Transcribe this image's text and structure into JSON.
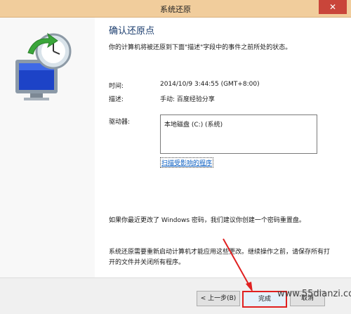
{
  "window": {
    "title": "系统还原",
    "close_glyph": "✕"
  },
  "main": {
    "heading": "确认还原点",
    "intro": "你的计算机将被还原到下面\"描述\"字段中的事件之前所处的状态。",
    "time_label": "时间:",
    "time_value": "2014/10/9 3:44:55 (GMT+8:00)",
    "desc_label": "描述:",
    "desc_value": "手动: 百度经验分享",
    "drives_label": "驱动器:",
    "drive_item": "本地磁盘 (C:) (系统)",
    "scan_link": "扫描受影响的程序",
    "password_note": "如果你最近更改了 Windows 密码，我们建议你创建一个密码重置盘。",
    "restart_note": "系统还原需要重新启动计算机才能应用这些更改。继续操作之前，请保存所有打开的文件并关闭所有程序。"
  },
  "footer": {
    "back_label": "< 上一步(B)",
    "finish_label": "完成",
    "cancel_label": "取消"
  },
  "watermark": "www.55dianzi.com",
  "colors": {
    "titlebar": "#f1cd9c",
    "close": "#c9453a",
    "link": "#0a5ec2",
    "highlight": "#e02020"
  },
  "icons": {
    "system_restore": "monitor-with-clock-and-green-arrow"
  }
}
